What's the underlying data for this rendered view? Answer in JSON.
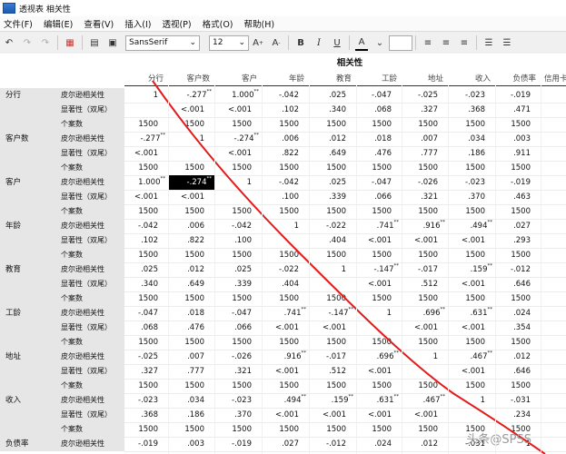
{
  "window": {
    "title": "透视表 相关性"
  },
  "menu": [
    "文件(F)",
    "编辑(E)",
    "查看(V)",
    "插入(I)",
    "透视(P)",
    "格式(O)",
    "帮助(H)"
  ],
  "toolbar": {
    "font": "SansSerif",
    "size": "12"
  },
  "table": {
    "title": "相关性",
    "columns": [
      "分行",
      "客户数",
      "客户",
      "年龄",
      "教育",
      "工龄",
      "地址",
      "收入",
      "负债率",
      "信用卡"
    ],
    "stat_labels": [
      "皮尔逊相关性",
      "显著性（双尾）",
      "个案数"
    ],
    "rows": [
      {
        "label": "分行",
        "r": [
          "1",
          [
            "-.277",
            "**"
          ],
          [
            "1.000",
            "**"
          ],
          "-.042",
          ".025",
          "-.047",
          "-.025",
          "-.023",
          "-.019"
        ],
        "p": [
          "",
          "<.001",
          "<.001",
          ".102",
          ".340",
          ".068",
          ".327",
          ".368",
          ".471"
        ],
        "n": [
          "1500",
          "1500",
          "1500",
          "1500",
          "1500",
          "1500",
          "1500",
          "1500",
          "1500"
        ]
      },
      {
        "label": "客户数",
        "r": [
          [
            "-.277",
            "**"
          ],
          "1",
          [
            "-.274",
            "**"
          ],
          ".006",
          ".012",
          ".018",
          ".007",
          ".034",
          ".003"
        ],
        "p": [
          "<.001",
          "",
          "<.001",
          ".822",
          ".649",
          ".476",
          ".777",
          ".186",
          ".911"
        ],
        "n": [
          "1500",
          "1500",
          "1500",
          "1500",
          "1500",
          "1500",
          "1500",
          "1500",
          "1500"
        ]
      },
      {
        "label": "客户",
        "r": [
          [
            "1.000",
            "**"
          ],
          [
            "-.274",
            "**"
          ],
          "1",
          "-.042",
          ".025",
          "-.047",
          "-.026",
          "-.023",
          "-.019"
        ],
        "p": [
          "<.001",
          "<.001",
          "",
          ".100",
          ".339",
          ".066",
          ".321",
          ".370",
          ".463"
        ],
        "n": [
          "1500",
          "1500",
          "1500",
          "1500",
          "1500",
          "1500",
          "1500",
          "1500",
          "1500"
        ]
      },
      {
        "label": "年龄",
        "r": [
          "-.042",
          ".006",
          "-.042",
          "1",
          "-.022",
          [
            ".741",
            "**"
          ],
          [
            ".916",
            "**"
          ],
          [
            ".494",
            "**"
          ],
          ".027"
        ],
        "p": [
          ".102",
          ".822",
          ".100",
          "",
          ".404",
          "<.001",
          "<.001",
          "<.001",
          ".293"
        ],
        "n": [
          "1500",
          "1500",
          "1500",
          "1500",
          "1500",
          "1500",
          "1500",
          "1500",
          "1500"
        ]
      },
      {
        "label": "教育",
        "r": [
          ".025",
          ".012",
          ".025",
          "-.022",
          "1",
          [
            "-.147",
            "**"
          ],
          "-.017",
          [
            ".159",
            "**"
          ],
          "-.012"
        ],
        "p": [
          ".340",
          ".649",
          ".339",
          ".404",
          "",
          "<.001",
          ".512",
          "<.001",
          ".646"
        ],
        "n": [
          "1500",
          "1500",
          "1500",
          "1500",
          "1500",
          "1500",
          "1500",
          "1500",
          "1500"
        ]
      },
      {
        "label": "工龄",
        "r": [
          "-.047",
          ".018",
          "-.047",
          [
            ".741",
            "**"
          ],
          [
            "-.147",
            "**"
          ],
          "1",
          [
            ".696",
            "**"
          ],
          [
            ".631",
            "**"
          ],
          ".024"
        ],
        "p": [
          ".068",
          ".476",
          ".066",
          "<.001",
          "<.001",
          "",
          "<.001",
          "<.001",
          ".354"
        ],
        "n": [
          "1500",
          "1500",
          "1500",
          "1500",
          "1500",
          "1500",
          "1500",
          "1500",
          "1500"
        ]
      },
      {
        "label": "地址",
        "r": [
          "-.025",
          ".007",
          "-.026",
          [
            ".916",
            "**"
          ],
          "-.017",
          [
            ".696",
            "**"
          ],
          "1",
          [
            ".467",
            "**"
          ],
          ".012"
        ],
        "p": [
          ".327",
          ".777",
          ".321",
          "<.001",
          ".512",
          "<.001",
          "",
          "<.001",
          ".646"
        ],
        "n": [
          "1500",
          "1500",
          "1500",
          "1500",
          "1500",
          "1500",
          "1500",
          "1500",
          "1500"
        ]
      },
      {
        "label": "收入",
        "r": [
          "-.023",
          ".034",
          "-.023",
          [
            ".494",
            "**"
          ],
          [
            ".159",
            "**"
          ],
          [
            ".631",
            "**"
          ],
          [
            ".467",
            "**"
          ],
          "1",
          "-.031"
        ],
        "p": [
          ".368",
          ".186",
          ".370",
          "<.001",
          "<.001",
          "<.001",
          "<.001",
          "",
          ".234"
        ],
        "n": [
          "1500",
          "1500",
          "1500",
          "1500",
          "1500",
          "1500",
          "1500",
          "1500",
          "1500"
        ]
      },
      {
        "label": "负债率",
        "r": [
          "-.019",
          ".003",
          "-.019",
          ".027",
          "-.012",
          ".024",
          ".012",
          "-.031",
          "1"
        ],
        "p": [],
        "n": []
      }
    ]
  },
  "watermark": "头条@SPSS"
}
